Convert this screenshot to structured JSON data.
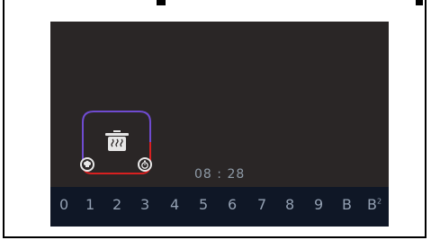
{
  "timer": {
    "hours": "08",
    "separator": ":",
    "minutes": "28"
  },
  "power_levels": [
    "0",
    "1",
    "2",
    "3",
    "4",
    "5",
    "6",
    "7",
    "8",
    "9",
    "B",
    "B"
  ],
  "boost_superscript": "2",
  "icons": {
    "zone": "pot-steam-icon",
    "left_badge": "chef-hat-icon",
    "right_badge": "stopwatch-icon"
  },
  "colors": {
    "screen_bg": "#2a2626",
    "level_bar_bg": "#0f1726",
    "zone_top": "#6f4bd0",
    "zone_bottom": "#d82020",
    "text": "#93a0b2"
  }
}
